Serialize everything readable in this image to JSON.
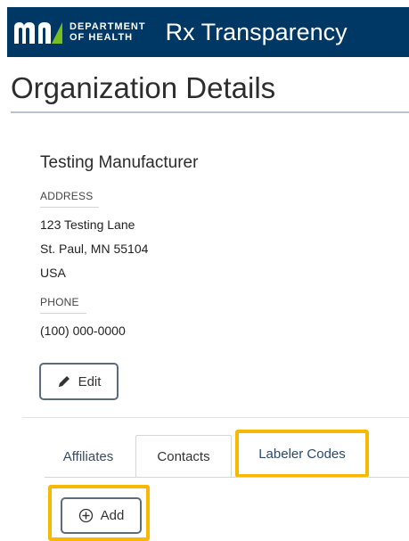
{
  "header": {
    "logo_text_line1": "DEPARTMENT",
    "logo_text_line2": "OF HEALTH",
    "app_title": "Rx Transparency",
    "background": "#003865"
  },
  "page": {
    "title": "Organization Details"
  },
  "organization": {
    "name": "Testing Manufacturer",
    "address_label": "ADDRESS",
    "address_line1": "123 Testing Lane",
    "address_line2": "St. Paul, MN 55104",
    "address_line3": "USA",
    "phone_label": "PHONE",
    "phone": "(100) 000-0000"
  },
  "actions": {
    "edit_label": "Edit",
    "edit_icon": "pencil-icon",
    "add_label": "Add",
    "add_icon": "plus-circle-icon"
  },
  "tabs": [
    {
      "label": "Affiliates",
      "active": false
    },
    {
      "label": "Contacts",
      "active": true
    },
    {
      "label": "Labeler Codes",
      "active": false,
      "highlighted": true
    }
  ],
  "colors": {
    "highlight": "#f6b800",
    "button_border": "#5a6c7e"
  }
}
